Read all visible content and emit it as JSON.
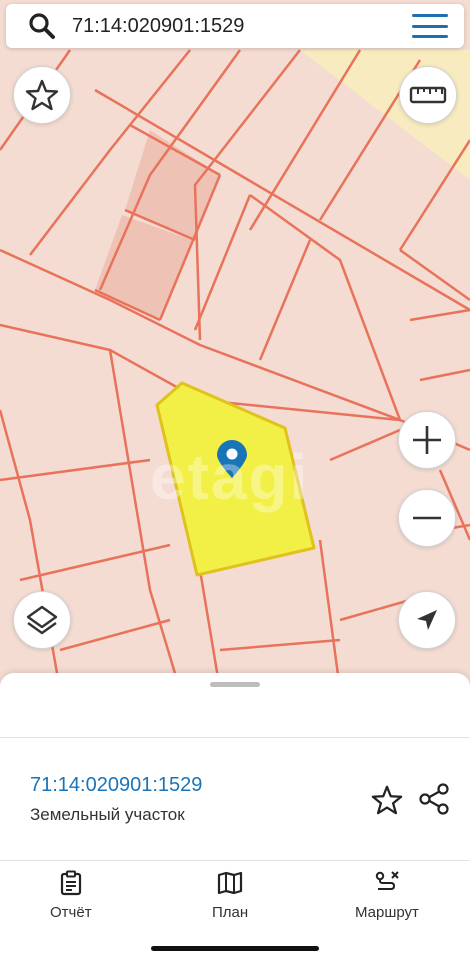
{
  "search": {
    "value": "71:14:020901:1529",
    "icon": "search-icon"
  },
  "map": {
    "watermark_text": "etagi",
    "colors": {
      "background": "#f4dcd2",
      "parcel_line": "#e8735a",
      "selected_parcel": "#f2f046",
      "selected_border": "#e0c21c",
      "pin": "#1a74b8",
      "zone": "#f7ebbf"
    }
  },
  "sheet": {
    "parcel_id": "71:14:020901:1529",
    "parcel_type": "Земельный участок"
  },
  "nav": {
    "items": [
      {
        "label": "Отчёт",
        "icon": "report-icon"
      },
      {
        "label": "План",
        "icon": "map-plan-icon"
      },
      {
        "label": "Маршрут",
        "icon": "route-icon"
      }
    ]
  }
}
